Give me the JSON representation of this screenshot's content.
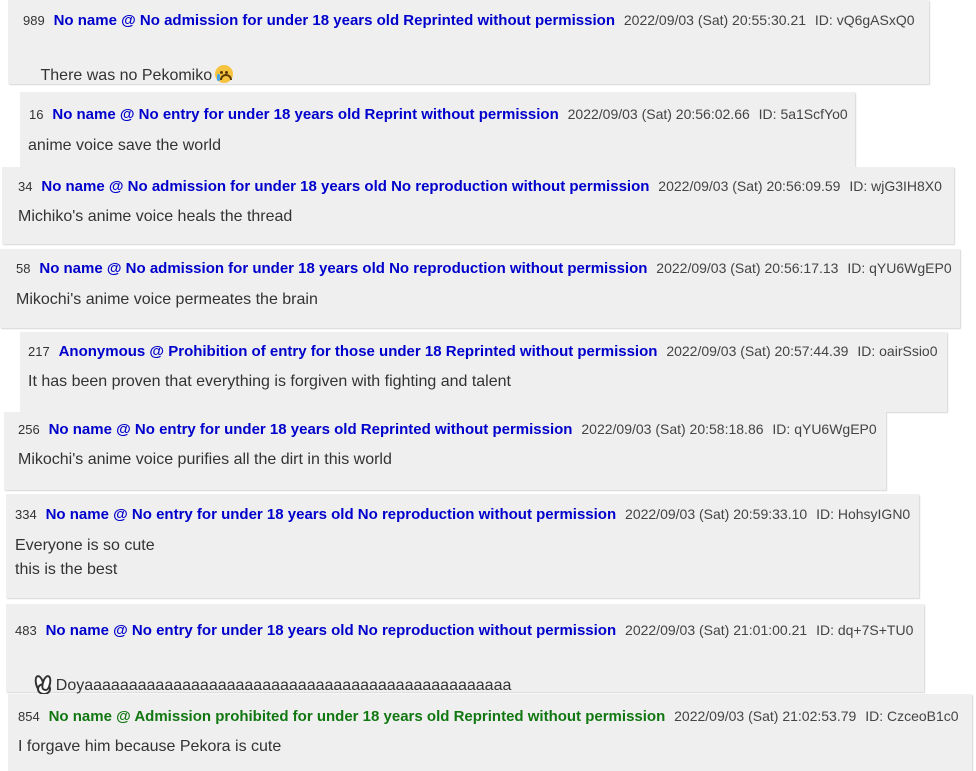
{
  "posts": [
    {
      "num": "989",
      "name": "No name @ No admission for under 18 years old Reprinted without permission",
      "date": "2022/09/03 (Sat) 20:55:30.21",
      "uid": "ID: vQ6gASxQ0",
      "body": "There was no Pekomiko",
      "body_icon": "crying-face-emoji-icon"
    },
    {
      "num": "16",
      "name": "No name @ No entry for under 18 years old Reprint without permission",
      "date": "2022/09/03 (Sat) 20:56:02.66",
      "uid": "ID: 5a1ScfYo0",
      "body": "anime voice save the world"
    },
    {
      "num": "34",
      "name": "No name @ No admission for under 18 years old No reproduction without permission",
      "date": "2022/09/03 (Sat) 20:56:09.59",
      "uid": "ID: wjG3IH8X0",
      "body": "Michiko's anime voice heals the thread"
    },
    {
      "num": "58",
      "name": "No name @ No admission for under 18 years old No reproduction without permission",
      "date": "2022/09/03 (Sat) 20:56:17.13",
      "uid": "ID: qYU6WgEP0",
      "body": "Mikochi's anime voice permeates the brain"
    },
    {
      "num": "217",
      "name": "Anonymous @ Prohibition of entry for those under 18 Reprinted without permission",
      "date": "2022/09/03 (Sat) 20:57:44.39",
      "uid": "ID: oairSsio0",
      "body": "It has been proven that everything is forgiven with fighting and talent"
    },
    {
      "num": "256",
      "name": "No name @ No entry for under 18 years old Reprinted without permission",
      "date": "2022/09/03 (Sat) 20:58:18.86",
      "uid": "ID: qYU6WgEP0",
      "body": "Mikochi's anime voice purifies all the dirt in this world"
    },
    {
      "num": "334",
      "name": "No name @ No entry for under 18 years old No reproduction without permission",
      "date": "2022/09/03 (Sat) 20:59:33.10",
      "uid": "ID: HohsyIGN0",
      "body": "Everyone is so cute\nthis is the best"
    },
    {
      "num": "483",
      "name": "No name @ No entry for under 18 years old No reproduction without permission",
      "date": "2022/09/03 (Sat) 21:01:00.21",
      "uid": "ID: dq+7S+TU0",
      "body": "Doyaaaaaaaaaaaaaaaaaaaaaaaaaaaaaaaaaaaaaaaaaaaaaaaa",
      "body_icon": "rabbit-emoji-icon"
    },
    {
      "num": "854",
      "name": "No name @ Admission prohibited for under 18 years old Reprinted without permission",
      "date": "2022/09/03 (Sat) 21:02:53.79",
      "uid": "ID: CzceoB1c0",
      "body": "I forgave him because Pekora is cute",
      "name_color": "#117711"
    }
  ],
  "colors": {
    "name": "#0000cc",
    "name_alt": "#117711",
    "post_bg": "#efefef"
  }
}
